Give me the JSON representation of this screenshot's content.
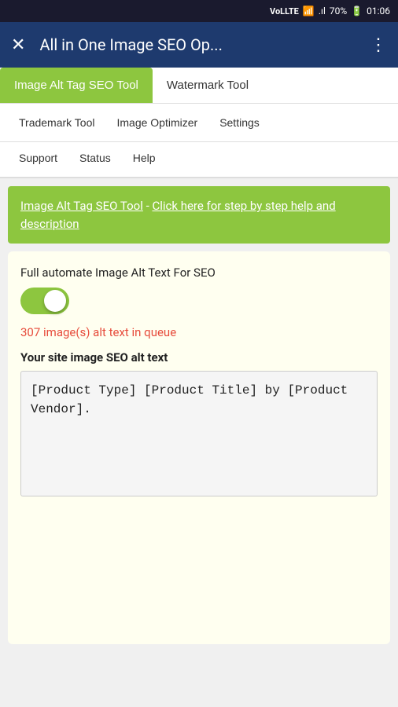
{
  "statusBar": {
    "signal": "VoLTE",
    "wifi": "WiFi",
    "networkBars": "4G",
    "battery": "70%",
    "batteryIcon": "🔋",
    "time": "01:06"
  },
  "header": {
    "title": "All in One Image SEO Op...",
    "closeIcon": "✕",
    "moreIcon": "⋮"
  },
  "nav": {
    "row1": [
      {
        "label": "Image Alt Tag SEO Tool",
        "active": true
      },
      {
        "label": "Watermark Tool",
        "active": false
      }
    ],
    "row2": [
      {
        "label": "Trademark Tool"
      },
      {
        "label": "Image Optimizer"
      },
      {
        "label": "Settings"
      }
    ],
    "row3": [
      {
        "label": "Support"
      },
      {
        "label": "Status"
      },
      {
        "label": "Help"
      }
    ]
  },
  "banner": {
    "toolName": "Image Alt Tag SEO Tool",
    "separator": " - ",
    "linkText": "Click here for step by step help and description"
  },
  "card": {
    "toggleLabel": "Full automate Image Alt Text For SEO",
    "toggleState": true,
    "queueStatus": "307 image(s) alt text in queue",
    "altTextLabel": "Your site image SEO alt text",
    "altTextValue": "[Product Type] [Product Title] by [Product Vendor]."
  }
}
